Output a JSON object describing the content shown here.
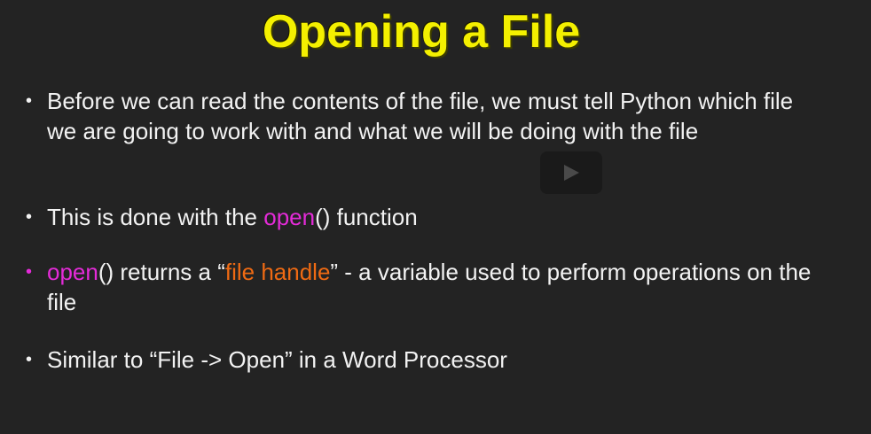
{
  "slide": {
    "title": "Opening a File",
    "bullets": [
      {
        "text": "Before we can read the contents of the file, we must tell Python which file we are going to work with and what we will be doing with the file"
      },
      {
        "pre": "This is done with the ",
        "open": "open",
        "post": "() function"
      },
      {
        "open": "open",
        "mid1": "() returns a “",
        "handle": "file handle",
        "mid2": "” - a variable used to perform operations on the file"
      },
      {
        "text": "Similar to “File -> Open” in a Word Processor"
      }
    ],
    "bullet_char": "•"
  },
  "colors": {
    "background": "#232323",
    "title": "#f4f000",
    "text": "#f2f2f2",
    "keyword": "#e42bd8",
    "highlight": "#ef6a13"
  },
  "icons": {
    "overlay": "play-icon"
  }
}
